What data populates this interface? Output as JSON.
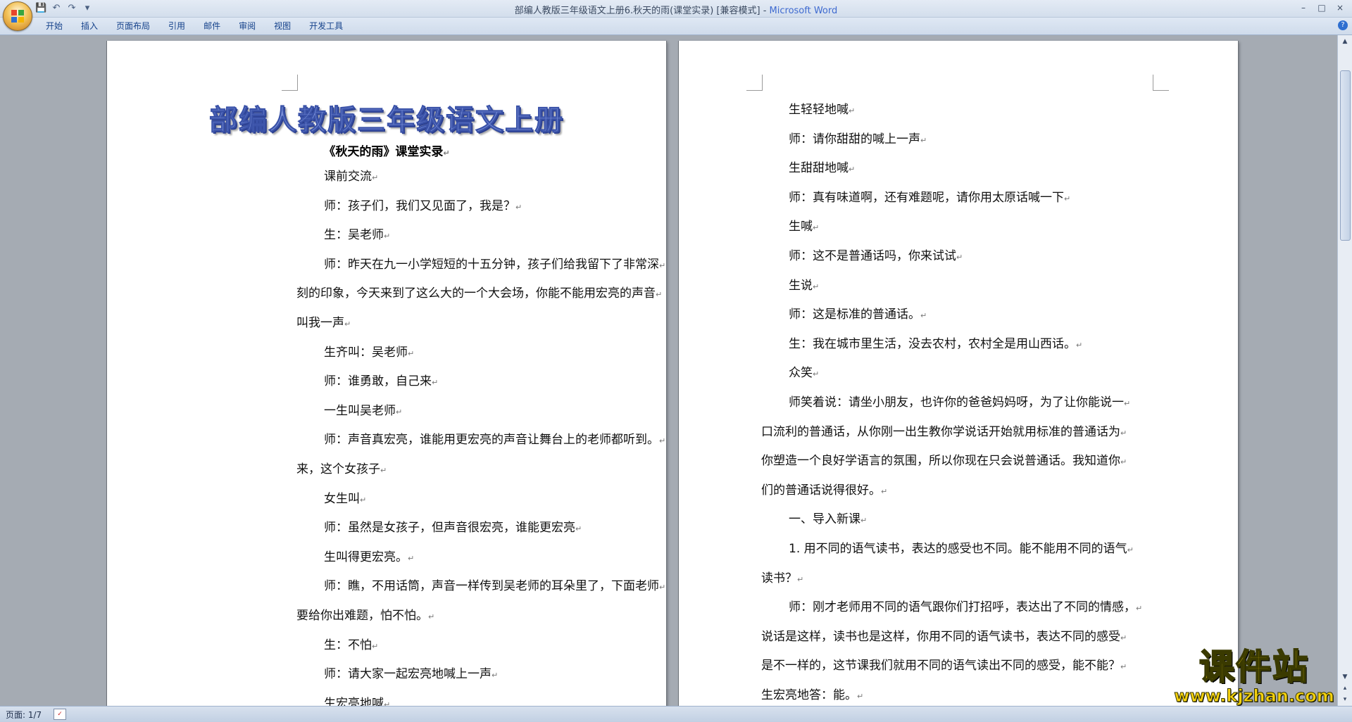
{
  "window": {
    "title_doc": "部编人教版三年级语文上册6.秋天的雨(课堂实录) [兼容模式] - ",
    "title_app": "Microsoft Word",
    "controls": [
      "–",
      "□",
      "×"
    ]
  },
  "qat": {
    "save": "💾",
    "undo": "↶",
    "redo": "↷",
    "more": "▾"
  },
  "ribbon": {
    "tabs": [
      "开始",
      "插入",
      "页面布局",
      "引用",
      "邮件",
      "审阅",
      "视图",
      "开发工具"
    ],
    "help": "?"
  },
  "left_page": {
    "wordart": "部编人教版三年级语文上册",
    "subtitle": "《秋天的雨》课堂实录",
    "lines": [
      "课前交流",
      "师：孩子们，我们又见面了，我是？",
      "生：吴老师",
      "师：昨天在九一小学短短的十五分钟，孩子们给我留下了非常深",
      "刻的印象，今天来到了这么大的一个大会场，你能不能用宏亮的声音",
      "叫我一声",
      "生齐叫：吴老师",
      "师：谁勇敢，自己来",
      "一生叫吴老师",
      "师：声音真宏亮，谁能用更宏亮的声音让舞台上的老师都听到。",
      "来，这个女孩子",
      "女生叫",
      "师：虽然是女孩子，但声音很宏亮，谁能更宏亮",
      "生叫得更宏亮。",
      "师：瞧，不用话筒，声音一样传到吴老师的耳朵里了，下面老师",
      "要给你出难题，怕不怕。",
      "生：不怕",
      "师：请大家一起宏亮地喊上一声",
      "生宏亮地喊"
    ]
  },
  "right_page": {
    "lines": [
      "生轻轻地喊",
      "师：请你甜甜的喊上一声",
      "生甜甜地喊",
      "师：真有味道啊，还有难题呢，请你用太原话喊一下",
      "生喊",
      "师：这不是普通话吗，你来试试",
      "生说",
      "师：这是标准的普通话。",
      "生：我在城市里生活，没去农村，农村全是用山西话。",
      "众笑",
      "师笑着说：请坐小朋友，也许你的爸爸妈妈呀，为了让你能说一",
      "口流利的普通话，从你刚一出生教你学说话开始就用标准的普通话为",
      "你塑造一个良好学语言的氛围，所以你现在只会说普通话。我知道你",
      "们的普通话说得很好。",
      "一、导入新课",
      "1. 用不同的语气读书，表达的感受也不同。能不能用不同的语气",
      "读书？",
      "师：刚才老师用不同的语气跟你们打招呼，表达出了不同的情感，",
      "说话是这样，读书也是这样，你用不同的语气读书，表达不同的感受",
      "是不一样的，这节课我们就用不同的语气读出不同的感受，能不能？",
      "生宏亮地答：能。"
    ]
  },
  "status": {
    "page": "页面: 1/7"
  },
  "watermark": {
    "main": "课件站",
    "url": "www.kjzhan.com"
  },
  "colors": {
    "ribbon_text": "#15428b",
    "wordart": "#7a90d8",
    "watermark": "#f5d10f"
  }
}
